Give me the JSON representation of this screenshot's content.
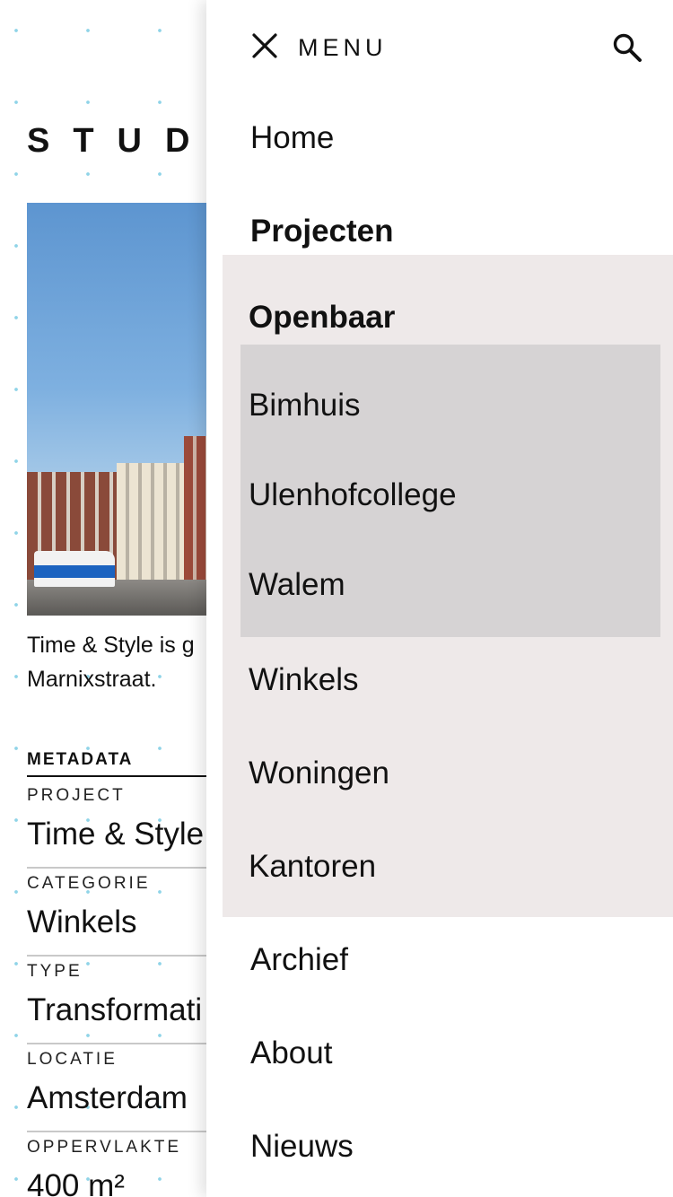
{
  "page": {
    "logo": "STUDIO",
    "caption": "Time & Style is g\nMarnixstraat.",
    "metadata_title": "METADATA",
    "metadata": [
      {
        "label": "PROJECT",
        "value": "Time & Style"
      },
      {
        "label": "CATEGORIE",
        "value": "Winkels"
      },
      {
        "label": "TYPE",
        "value": "Transformati"
      },
      {
        "label": "LOCATIE",
        "value": "Amsterdam"
      },
      {
        "label": "OPPERVLAKTE",
        "value": "400 m²"
      }
    ]
  },
  "drawer": {
    "menu_label": "MENU",
    "close_icon": "close-icon",
    "search_icon": "search-icon",
    "items": {
      "home": "Home",
      "projecten": "Projecten",
      "archief": "Archief",
      "about": "About",
      "nieuws": "Nieuws"
    },
    "projecten_sub": {
      "openbaar": "Openbaar",
      "openbaar_items": [
        "Bimhuis",
        "Ulenhofcollege",
        "Walem"
      ],
      "winkels": "Winkels",
      "woningen": "Woningen",
      "kantoren": "Kantoren"
    }
  },
  "colors": {
    "sub_panel_bg": "#eee9e9",
    "sub_sub_panel_bg": "#d6d3d4",
    "dot_accent": "#8fd4e8"
  }
}
